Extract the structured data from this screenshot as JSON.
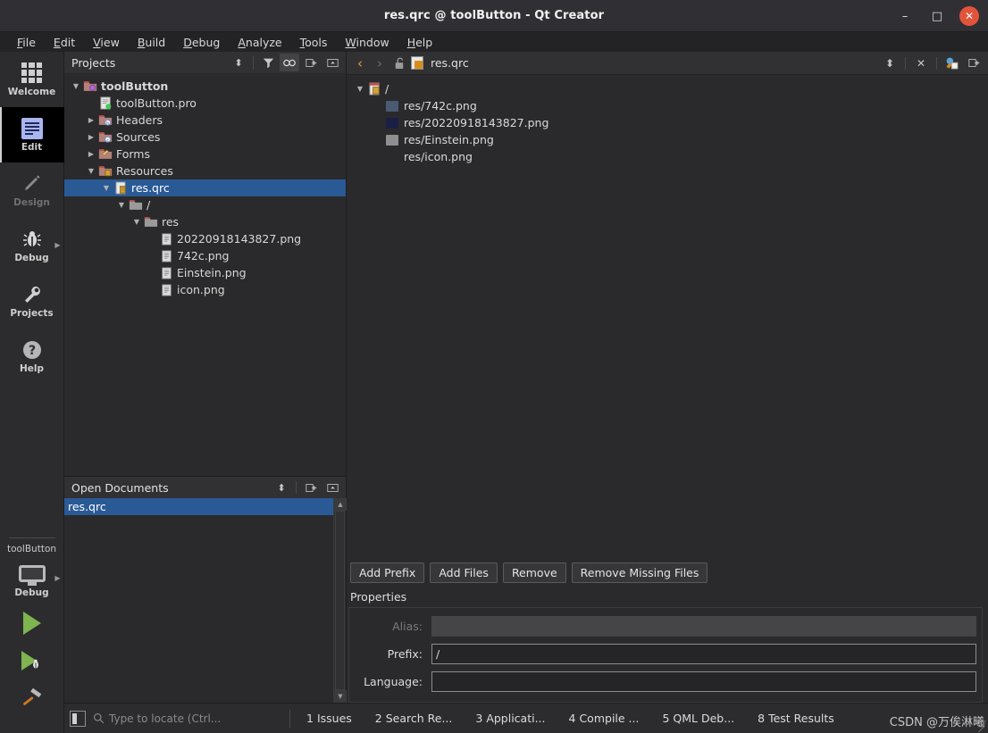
{
  "window": {
    "title": "res.qrc @ toolButton - Qt Creator",
    "minimize": "–",
    "maximize": "□",
    "close": "✕"
  },
  "menubar": {
    "items": [
      {
        "mnemonic": "F",
        "rest": "ile"
      },
      {
        "mnemonic": "E",
        "rest": "dit"
      },
      {
        "mnemonic": "V",
        "rest": "iew"
      },
      {
        "mnemonic": "B",
        "rest": "uild"
      },
      {
        "mnemonic": "D",
        "rest": "ebug"
      },
      {
        "mnemonic": "A",
        "rest": "nalyze"
      },
      {
        "mnemonic": "T",
        "rest": "ools"
      },
      {
        "mnemonic": "W",
        "rest": "indow"
      },
      {
        "mnemonic": "H",
        "rest": "elp"
      }
    ]
  },
  "modebar": {
    "modes": [
      {
        "label": "Welcome",
        "icon": "grid-icon",
        "active": false,
        "dim": false
      },
      {
        "label": "Edit",
        "icon": "document-icon",
        "active": true,
        "dim": false
      },
      {
        "label": "Design",
        "icon": "pencil-icon",
        "active": false,
        "dim": true
      },
      {
        "label": "Debug",
        "icon": "bug-icon",
        "active": false,
        "dim": false
      },
      {
        "label": "Projects",
        "icon": "wrench-icon",
        "active": false,
        "dim": false
      },
      {
        "label": "Help",
        "icon": "question-icon",
        "active": false,
        "dim": false
      }
    ],
    "kit": {
      "project": "toolButton",
      "build_config": "Debug",
      "run_label": "run-button",
      "debug_label": "start-debugging-button",
      "build_label": "build-button"
    }
  },
  "projects_panel": {
    "title": "Projects",
    "header_icons": [
      "updown-arrows-icon",
      "filter-icon",
      "link-icon",
      "split-icon",
      "collapse-icon"
    ],
    "tree": [
      {
        "depth": 0,
        "label": "toolButton",
        "icon": "project-icon",
        "twisty": "down",
        "bold": true,
        "selected": false
      },
      {
        "depth": 1,
        "label": "toolButton.pro",
        "icon": "qt-pro-file-icon",
        "twisty": "",
        "bold": false,
        "selected": false
      },
      {
        "depth": 1,
        "label": "Headers",
        "icon": "folder-h-icon",
        "twisty": "right",
        "bold": false,
        "selected": false
      },
      {
        "depth": 1,
        "label": "Sources",
        "icon": "folder-cpp-icon",
        "twisty": "right",
        "bold": false,
        "selected": false
      },
      {
        "depth": 1,
        "label": "Forms",
        "icon": "folder-forms-icon",
        "twisty": "right",
        "bold": false,
        "selected": false
      },
      {
        "depth": 1,
        "label": "Resources",
        "icon": "folder-resource-icon",
        "twisty": "down",
        "bold": false,
        "selected": false
      },
      {
        "depth": 2,
        "label": "res.qrc",
        "icon": "qrc-file-icon",
        "twisty": "down",
        "bold": false,
        "selected": true
      },
      {
        "depth": 3,
        "label": "/",
        "icon": "folder-icon",
        "twisty": "down",
        "bold": false,
        "selected": false
      },
      {
        "depth": 4,
        "label": "res",
        "icon": "folder-icon",
        "twisty": "down",
        "bold": false,
        "selected": false
      },
      {
        "depth": 5,
        "label": "20220918143827.png",
        "icon": "file-icon",
        "twisty": "",
        "bold": false,
        "selected": false
      },
      {
        "depth": 5,
        "label": "742c.png",
        "icon": "file-icon",
        "twisty": "",
        "bold": false,
        "selected": false
      },
      {
        "depth": 5,
        "label": "Einstein.png",
        "icon": "file-icon",
        "twisty": "",
        "bold": false,
        "selected": false
      },
      {
        "depth": 5,
        "label": "icon.png",
        "icon": "file-icon",
        "twisty": "",
        "bold": false,
        "selected": false
      }
    ]
  },
  "open_documents": {
    "title": "Open Documents",
    "header_icons": [
      "updown-arrows-icon",
      "split-icon",
      "collapse-icon"
    ],
    "items": [
      {
        "label": "res.qrc",
        "selected": true
      }
    ]
  },
  "editor": {
    "toolbar": {
      "back": "‹",
      "forward": "›",
      "lock": "unlocked-padlock-icon",
      "filename": "res.qrc",
      "updown": "updown-arrows-icon",
      "close": "✕",
      "extra": "split-editor-icon",
      "right": "split-icon"
    },
    "resource_tree": [
      {
        "depth": 0,
        "label": "/",
        "icon": "qrc-prefix-icon",
        "twisty": "down",
        "thumb": "none"
      },
      {
        "depth": 1,
        "label": "res/742c.png",
        "icon": "image-thumb",
        "twisty": "",
        "thumb": "#4a5a72"
      },
      {
        "depth": 1,
        "label": "res/20220918143827.png",
        "icon": "image-thumb",
        "twisty": "",
        "thumb": "#1b1f45"
      },
      {
        "depth": 1,
        "label": "res/Einstein.png",
        "icon": "image-thumb",
        "twisty": "",
        "thumb": "#8f8f8f"
      },
      {
        "depth": 1,
        "label": "res/icon.png",
        "icon": "image-thumb",
        "twisty": "",
        "thumb": "#2a2a2c"
      }
    ],
    "buttons": [
      {
        "label": "Add Prefix",
        "name": "add-prefix-button"
      },
      {
        "label": "Add Files",
        "name": "add-files-button"
      },
      {
        "label": "Remove",
        "name": "remove-button"
      },
      {
        "label": "Remove Missing Files",
        "name": "remove-missing-files-button"
      }
    ],
    "properties": {
      "title": "Properties",
      "alias": {
        "label": "Alias:",
        "value": "",
        "disabled": true
      },
      "prefix": {
        "label": "Prefix:",
        "value": "/",
        "disabled": false
      },
      "language": {
        "label": "Language:",
        "value": "",
        "disabled": false
      }
    }
  },
  "statusbar": {
    "sidebar_toggle": "sidebar-toggle-icon",
    "locator_placeholder": "Type to locate (Ctrl...",
    "panes": [
      {
        "num": "1",
        "label": "Issues"
      },
      {
        "num": "2",
        "label": "Search Re..."
      },
      {
        "num": "3",
        "label": "Applicati..."
      },
      {
        "num": "4",
        "label": "Compile ..."
      },
      {
        "num": "5",
        "label": "QML Deb..."
      },
      {
        "num": "8",
        "label": "Test Results"
      }
    ],
    "watermark": "CSDN @万俟淋曦"
  },
  "colors": {
    "selection_blue": "#2a5a96",
    "panel_bg": "#2a2a2c",
    "header_bg": "#313134",
    "close_red": "#e2543a",
    "accent_gold": "#d8a33a",
    "run_green": "#7fb450"
  }
}
